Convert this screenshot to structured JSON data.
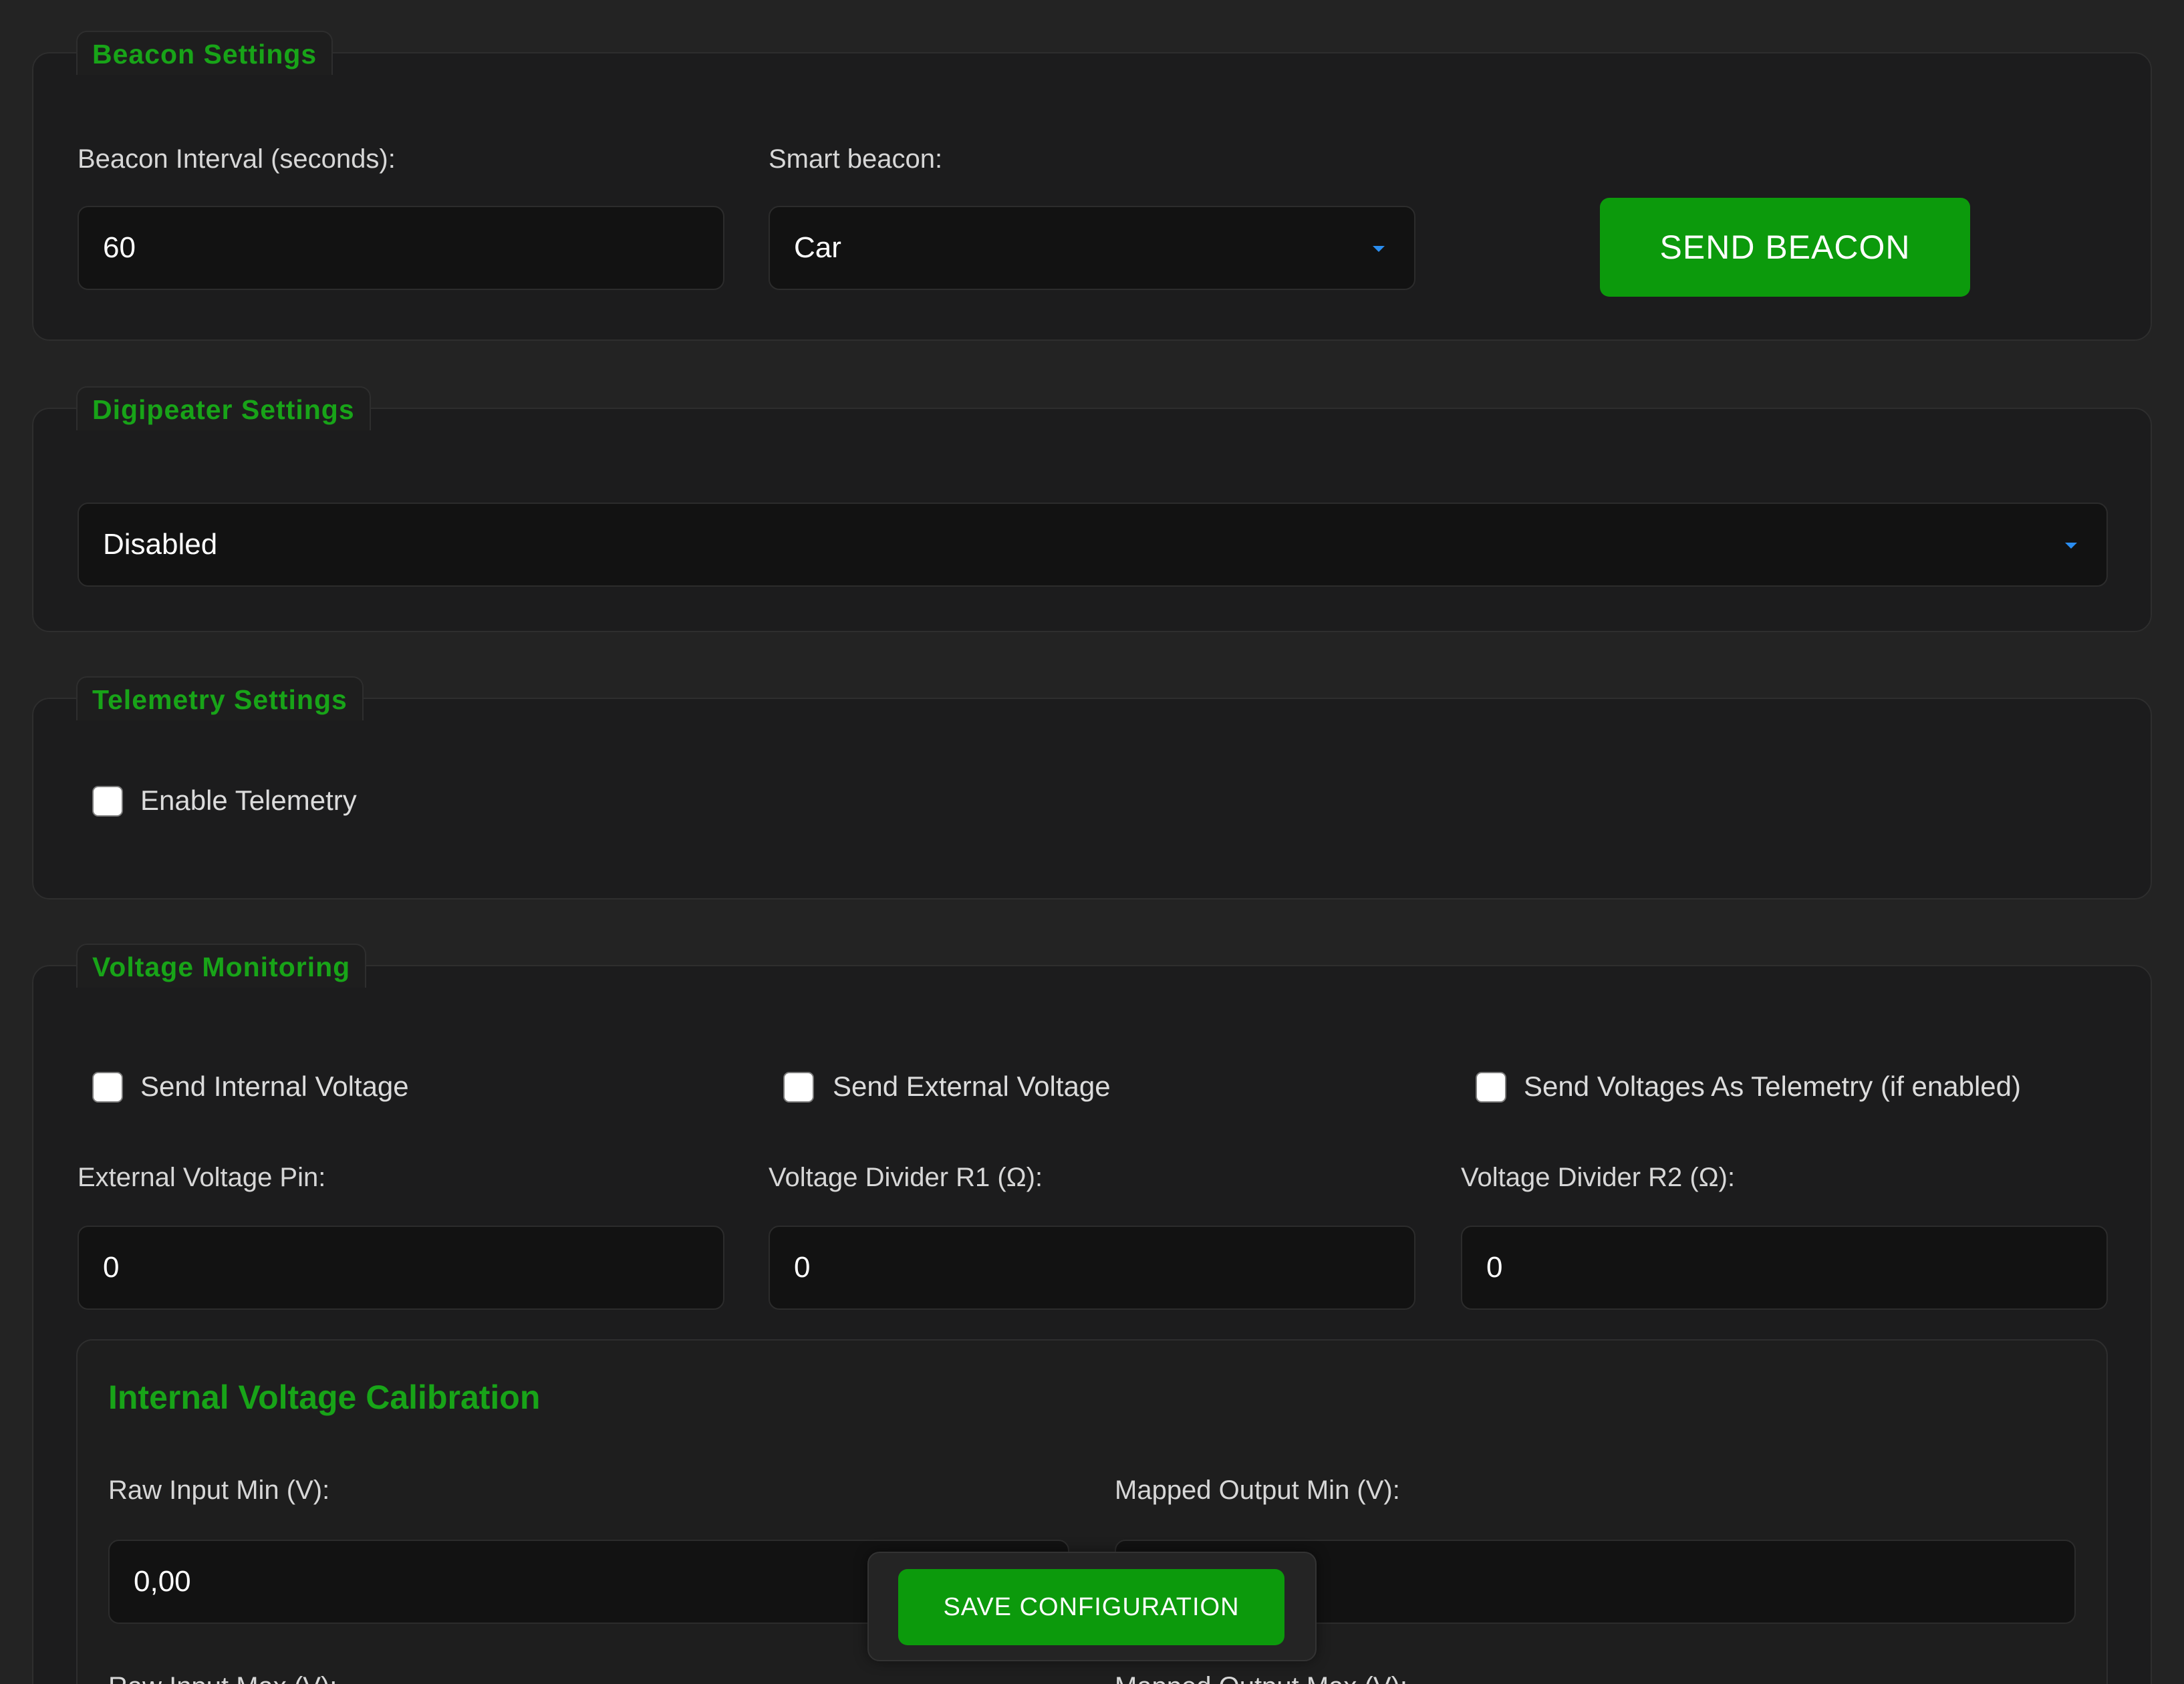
{
  "beacon": {
    "legend": "Beacon Settings",
    "interval_label": "Beacon Interval (seconds):",
    "interval_value": "60",
    "smart_label": "Smart beacon:",
    "smart_value": "Car",
    "send_button": "SEND BEACON"
  },
  "digipeater": {
    "legend": "Digipeater Settings",
    "mode_value": "Disabled"
  },
  "telemetry": {
    "legend": "Telemetry Settings",
    "enable_label": "Enable Telemetry",
    "enable_checked": false
  },
  "voltage": {
    "legend": "Voltage Monitoring",
    "send_internal_label": "Send Internal Voltage",
    "send_external_label": "Send External Voltage",
    "send_as_telemetry_label": "Send Voltages As Telemetry (if enabled)",
    "external_pin_label": "External Voltage Pin:",
    "external_pin_value": "0",
    "r1_label": "Voltage Divider R1 (Ω):",
    "r1_value": "0",
    "r2_label": "Voltage Divider R2 (Ω):",
    "r2_value": "0",
    "calibration": {
      "title": "Internal Voltage Calibration",
      "raw_min_label": "Raw Input Min (V):",
      "raw_min_value": "0,00",
      "mapped_min_label": "Mapped Output Min (V):",
      "raw_max_label": "Raw Input Max (V):",
      "mapped_max_label": "Mapped Output Max (V):"
    }
  },
  "save_button": "SAVE CONFIGURATION",
  "colors": {
    "accent_green": "#18a418",
    "button_green": "#0c9a0c",
    "caret_blue": "#2a8df0",
    "background": "#232323",
    "panel": "#1c1c1d",
    "input": "#121212"
  }
}
